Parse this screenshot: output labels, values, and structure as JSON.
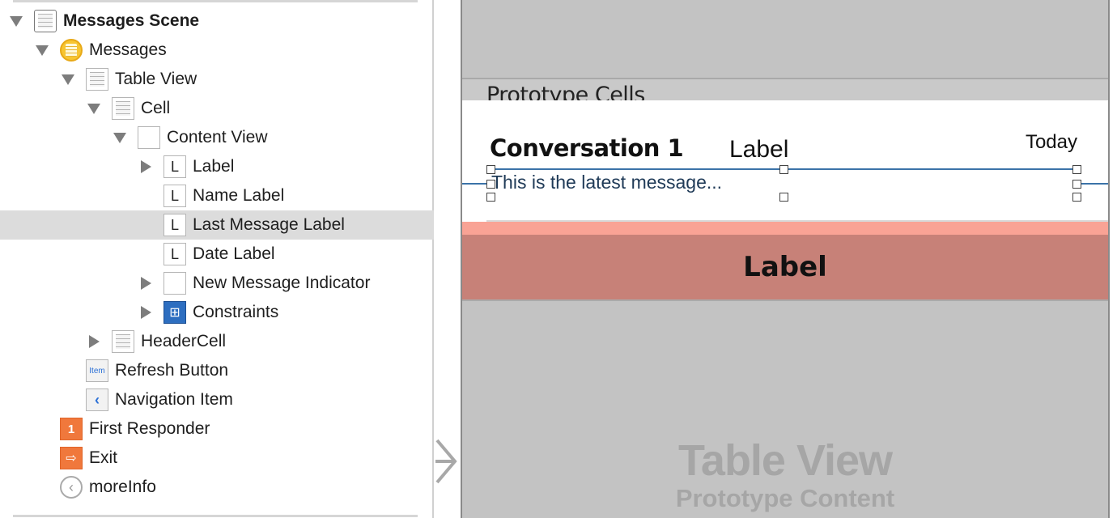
{
  "outline": {
    "items": [
      {
        "label": "Messages Scene",
        "icon": "scene-icon",
        "disclosure": "expanded",
        "depth": 0,
        "bold": true
      },
      {
        "label": "Messages",
        "icon": "view-controller-icon",
        "disclosure": "expanded",
        "depth": 1
      },
      {
        "label": "Table View",
        "icon": "table-view-icon",
        "disclosure": "expanded",
        "depth": 2
      },
      {
        "label": "Cell",
        "icon": "table-cell-icon",
        "disclosure": "expanded",
        "depth": 3
      },
      {
        "label": "Content View",
        "icon": "view-icon",
        "disclosure": "expanded",
        "depth": 4
      },
      {
        "label": "Label",
        "icon": "label-icon",
        "disclosure": "collapsed",
        "depth": 5
      },
      {
        "label": "Name Label",
        "icon": "label-icon",
        "disclosure": "none",
        "depth": 5
      },
      {
        "label": "Last Message Label",
        "icon": "label-icon",
        "disclosure": "none",
        "depth": 5,
        "selected": true
      },
      {
        "label": "Date Label",
        "icon": "label-icon",
        "disclosure": "none",
        "depth": 5
      },
      {
        "label": "New Message Indicator",
        "icon": "view-icon",
        "disclosure": "collapsed",
        "depth": 5
      },
      {
        "label": "Constraints",
        "icon": "constraints-icon",
        "disclosure": "collapsed",
        "depth": 5
      },
      {
        "label": "HeaderCell",
        "icon": "table-cell-icon",
        "disclosure": "collapsed",
        "depth": 3
      },
      {
        "label": "Refresh Button",
        "icon": "bar-button-item-icon",
        "disclosure": "none",
        "depth": 2
      },
      {
        "label": "Navigation Item",
        "icon": "navigation-item-icon",
        "disclosure": "none",
        "depth": 2
      },
      {
        "label": "First Responder",
        "icon": "first-responder-icon",
        "disclosure": "none",
        "depth": 1
      },
      {
        "label": "Exit",
        "icon": "exit-icon",
        "disclosure": "none",
        "depth": 1
      },
      {
        "label": "moreInfo",
        "icon": "segue-icon",
        "disclosure": "none",
        "depth": 1
      }
    ],
    "label_icon_glyph": "L",
    "item_icon_text": "Item"
  },
  "canvas": {
    "section_header": "Prototype Cells",
    "cell": {
      "name": "Conversation 1",
      "label": "Label",
      "date": "Today",
      "last_message": "This is the latest message..."
    },
    "header_cell_label": "Label",
    "placeholder_title": "Table View",
    "placeholder_subtitle": "Prototype Content",
    "colors": {
      "scene": "#c3c3c3",
      "header_light": "#f9a395",
      "header_dark": "#c78178",
      "constraint": "#3b73a8"
    }
  }
}
